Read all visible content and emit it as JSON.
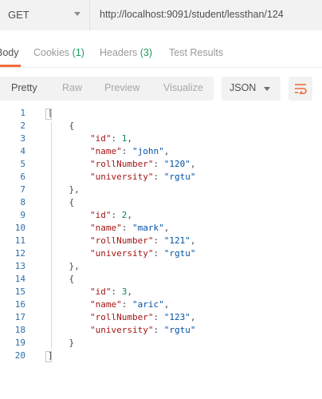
{
  "request": {
    "method": "GET",
    "url": "http://localhost:9091/student/lessthan/124"
  },
  "response_tabs": [
    {
      "label": "Body",
      "count": ""
    },
    {
      "label": "Cookies",
      "count": "(1)"
    },
    {
      "label": "Headers",
      "count": "(3)"
    },
    {
      "label": "Test Results",
      "count": ""
    }
  ],
  "format_toolbar": {
    "buttons": [
      "Pretty",
      "Raw",
      "Preview",
      "Visualize"
    ],
    "active": "Pretty",
    "language": "JSON"
  },
  "code_lines": [
    {
      "no": "1",
      "text": "["
    },
    {
      "no": "2",
      "text": "    {"
    },
    {
      "no": "3",
      "text": "        \"id\": 1,"
    },
    {
      "no": "4",
      "text": "        \"name\": \"john\","
    },
    {
      "no": "5",
      "text": "        \"rollNumber\": \"120\","
    },
    {
      "no": "6",
      "text": "        \"university\": \"rgtu\""
    },
    {
      "no": "7",
      "text": "    },"
    },
    {
      "no": "8",
      "text": "    {"
    },
    {
      "no": "9",
      "text": "        \"id\": 2,"
    },
    {
      "no": "10",
      "text": "        \"name\": \"mark\","
    },
    {
      "no": "11",
      "text": "        \"rollNumber\": \"121\","
    },
    {
      "no": "12",
      "text": "        \"university\": \"rgtu\""
    },
    {
      "no": "13",
      "text": "    },"
    },
    {
      "no": "14",
      "text": "    {"
    },
    {
      "no": "15",
      "text": "        \"id\": 3,"
    },
    {
      "no": "16",
      "text": "        \"name\": \"aric\","
    },
    {
      "no": "17",
      "text": "        \"rollNumber\": \"123\","
    },
    {
      "no": "18",
      "text": "        \"university\": \"rgtu\""
    },
    {
      "no": "19",
      "text": "    }"
    },
    {
      "no": "20",
      "text": "]"
    }
  ],
  "colors": {
    "accent": "#f26b3a",
    "count": "#1a9c5b",
    "line_number": "#2f6ea8",
    "json_key": "#a31515",
    "json_string": "#0451a5",
    "json_number": "#098658"
  },
  "icons": {
    "method_dropdown": "chevron-down-icon",
    "language_dropdown": "chevron-down-icon",
    "wrap": "wrap-lines-icon"
  }
}
